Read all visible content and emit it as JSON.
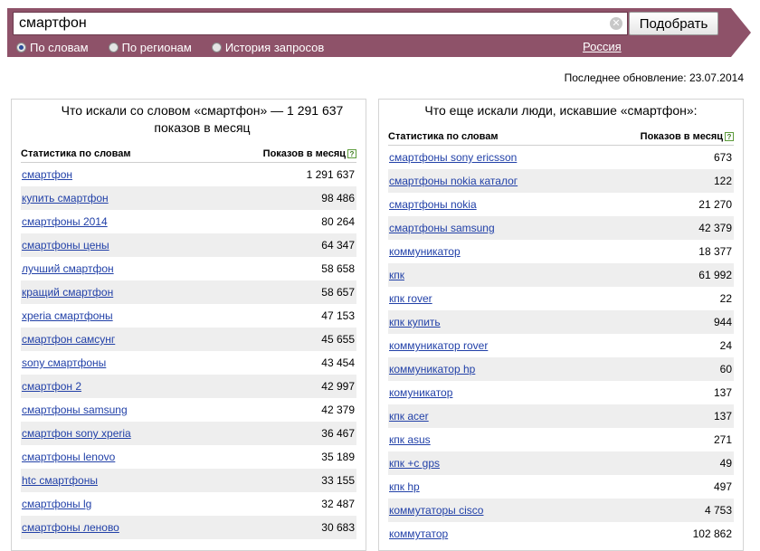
{
  "search": {
    "query": "смартфон",
    "clear_icon": "✕",
    "submit_label": "Подобрать"
  },
  "modes": [
    {
      "label": "По словам",
      "selected": true
    },
    {
      "label": "По регионам",
      "selected": false
    },
    {
      "label": "История запросов",
      "selected": false
    }
  ],
  "region": "Россия",
  "updated": "Последнее обновление: 23.07.2014",
  "left_panel": {
    "title": "Что искали со словом «смартфон» — 1 291 637 показов в месяц",
    "col_query": "Статистика по словам",
    "col_count": "Показов в месяц",
    "help": "?",
    "rows": [
      {
        "q": "смартфон",
        "n": "1 291 637"
      },
      {
        "q": "купить смартфон",
        "n": "98 486"
      },
      {
        "q": "смартфоны 2014",
        "n": "80 264"
      },
      {
        "q": "смартфоны цены",
        "n": "64 347"
      },
      {
        "q": "лучший смартфон",
        "n": "58 658"
      },
      {
        "q": "кращий смартфон",
        "n": "58 657"
      },
      {
        "q": "xperia смартфоны",
        "n": "47 153"
      },
      {
        "q": "смартфон самсунг",
        "n": "45 655"
      },
      {
        "q": "sony смартфоны",
        "n": "43 454"
      },
      {
        "q": "смартфон 2",
        "n": "42 997"
      },
      {
        "q": "смартфоны samsung",
        "n": "42 379"
      },
      {
        "q": "смартфон sony xperia",
        "n": "36 467"
      },
      {
        "q": "смартфоны lenovo",
        "n": "35 189"
      },
      {
        "q": "htc смартфоны",
        "n": "33 155"
      },
      {
        "q": "смартфоны lg",
        "n": "32 487"
      },
      {
        "q": "смартфоны леново",
        "n": "30 683"
      }
    ]
  },
  "right_panel": {
    "title": "Что еще искали люди, искавшие «смартфон»:",
    "col_query": "Статистика по словам",
    "col_count": "Показов в месяц",
    "help": "?",
    "rows": [
      {
        "q": "смартфоны sony ericsson",
        "n": "673"
      },
      {
        "q": "смартфоны nokia каталог",
        "n": "122"
      },
      {
        "q": "смартфоны nokia",
        "n": "21 270"
      },
      {
        "q": "смартфоны samsung",
        "n": "42 379"
      },
      {
        "q": "коммуникатор",
        "n": "18 377"
      },
      {
        "q": "кпк",
        "n": "61 992"
      },
      {
        "q": "кпк rover",
        "n": "22"
      },
      {
        "q": "кпк купить",
        "n": "944"
      },
      {
        "q": "коммуникатор rover",
        "n": "24"
      },
      {
        "q": "коммуникатор hp",
        "n": "60"
      },
      {
        "q": "комуникатор",
        "n": "137"
      },
      {
        "q": "кпк acer",
        "n": "137"
      },
      {
        "q": "кпк asus",
        "n": "271"
      },
      {
        "q": "кпк +с gps",
        "n": "49"
      },
      {
        "q": "кпк hp",
        "n": "497"
      },
      {
        "q": "коммутаторы cisco",
        "n": "4 753"
      },
      {
        "q": "коммутатор",
        "n": "102 862"
      }
    ]
  }
}
